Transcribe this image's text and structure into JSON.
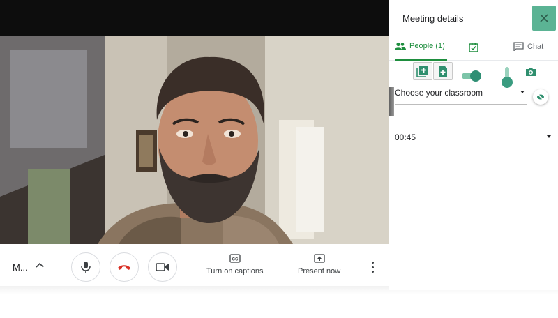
{
  "panel": {
    "title": "Meeting details",
    "close_icon": "close-icon",
    "tabs": [
      {
        "label": "People (1)",
        "icon": "people-icon",
        "active": true
      },
      {
        "label": "",
        "icon": "task-check-icon",
        "active": false
      },
      {
        "label": "Chat",
        "icon": "chat-icon",
        "active": false
      }
    ],
    "toolbar": {
      "add_frame_icon": "add-frame-icon",
      "add_doc_icon": "add-document-icon",
      "toggle_on": true,
      "slider_level": 0.3,
      "camera_icon": "camera-icon"
    },
    "classroom_select": {
      "value": "Choose your classroom"
    },
    "time_select": {
      "value": "00:45"
    },
    "visibility_icon": "eye-off-icon"
  },
  "controls": {
    "meeting_code": "M...",
    "mic_icon": "microphone-icon",
    "hangup_icon": "hang-up-icon",
    "camera_icon": "video-camera-icon",
    "captions_label": "Turn on captions",
    "present_label": "Present now",
    "more_icon": "more-vert-icon"
  },
  "colors": {
    "accent_green": "#1e8e3e",
    "close_bg": "#5bb394",
    "hangup_red": "#d93025"
  }
}
